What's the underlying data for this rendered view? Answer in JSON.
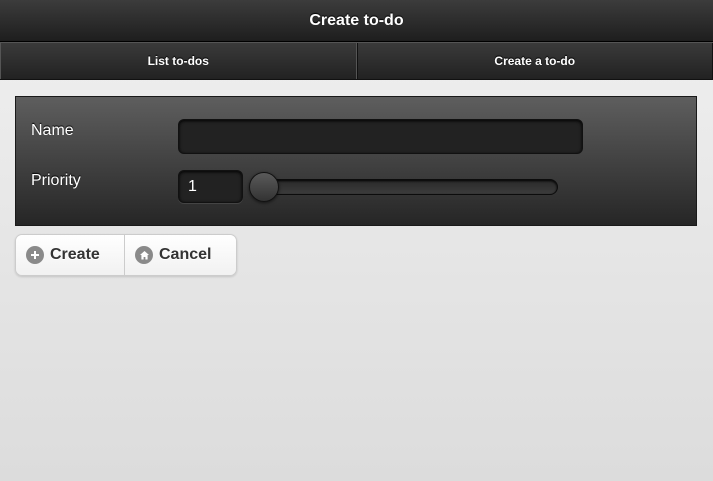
{
  "header": {
    "title": "Create to-do"
  },
  "navbar": {
    "items": [
      {
        "label": "List to-dos"
      },
      {
        "label": "Create a to-do"
      }
    ]
  },
  "form": {
    "name": {
      "label": "Name",
      "value": ""
    },
    "priority": {
      "label": "Priority",
      "value": "1",
      "slider_fraction": 0
    }
  },
  "actions": {
    "create": {
      "label": "Create",
      "icon": "plus-icon"
    },
    "cancel": {
      "label": "Cancel",
      "icon": "home-icon"
    }
  },
  "colors": {
    "header_bg": "#2b2b2b",
    "page_bg": "#e6e6e6",
    "button_icon": "#8a8a8a"
  }
}
